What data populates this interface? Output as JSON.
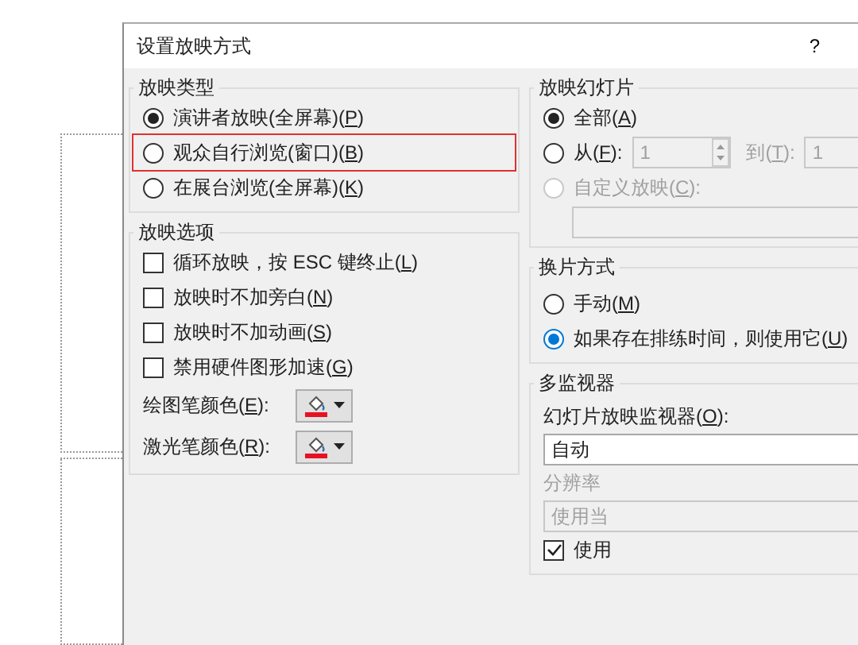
{
  "window": {
    "title": "设置放映方式",
    "help": "?"
  },
  "show_type": {
    "title": "放映类型",
    "options": [
      {
        "label": "演讲者放映(全屏幕)(",
        "access_key": "P",
        "label_end": ")",
        "selected": true,
        "highlighted": false
      },
      {
        "label": "观众自行浏览(窗口)(",
        "access_key": "B",
        "label_end": ")",
        "selected": false,
        "highlighted": true
      },
      {
        "label": "在展台浏览(全屏幕)(",
        "access_key": "K",
        "label_end": ")",
        "selected": false,
        "highlighted": false
      }
    ]
  },
  "show_options": {
    "title": "放映选项",
    "checkboxes": [
      {
        "label": "循环放映，按 ESC 键终止(",
        "access_key": "L",
        "label_end": ")",
        "checked": false
      },
      {
        "label": "放映时不加旁白(",
        "access_key": "N",
        "label_end": ")",
        "checked": false
      },
      {
        "label": "放映时不加动画(",
        "access_key": "S",
        "label_end": ")",
        "checked": false
      },
      {
        "label": "禁用硬件图形加速(",
        "access_key": "G",
        "label_end": ")",
        "checked": false
      }
    ],
    "pens": [
      {
        "label": "绘图笔颜色(",
        "access_key": "E",
        "label_end": "):",
        "color": "#e81123"
      },
      {
        "label": "激光笔颜色(",
        "access_key": "R",
        "label_end": "):",
        "color": "#e81123"
      }
    ]
  },
  "show_slides": {
    "title": "放映幻灯片",
    "options": [
      {
        "kind": "all",
        "label": "全部(",
        "access_key": "A",
        "label_end": ")",
        "selected": true,
        "disabled": false
      },
      {
        "kind": "range",
        "label": "从(",
        "access_key": "F",
        "label_end": "):",
        "selected": false,
        "disabled": false,
        "from": "1",
        "to_label": "到(",
        "to_key": "T",
        "to_label_end": "):",
        "to": "1"
      },
      {
        "kind": "custom",
        "label": "自定义放映(",
        "access_key": "C",
        "label_end": "):",
        "selected": false,
        "disabled": true
      }
    ]
  },
  "advance": {
    "title": "换片方式",
    "options": [
      {
        "label": "手动(",
        "access_key": "M",
        "label_end": ")",
        "selected": false,
        "focused": false
      },
      {
        "label": "如果存在排练时间，则使用它(",
        "access_key": "U",
        "label_end": ")",
        "selected": true,
        "focused": true
      }
    ]
  },
  "monitors": {
    "title": "多监视器",
    "monitor_label": "幻灯片放映监视器(",
    "monitor_key": "O",
    "monitor_label_end": "):",
    "monitor": "自动",
    "resolution_label": "分辨率",
    "resolution": "使用当",
    "presenter_view": {
      "label": "使用",
      "checked": true
    }
  }
}
